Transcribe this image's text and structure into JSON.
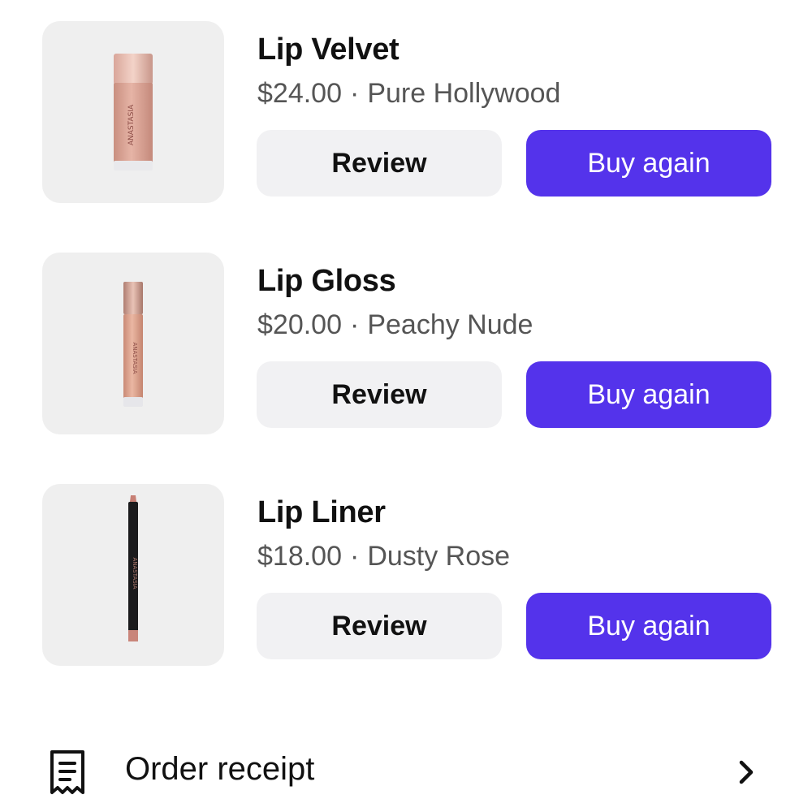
{
  "items": [
    {
      "name": "Lip Velvet",
      "price": "$24.00",
      "separator": "·",
      "shade": "Pure Hollywood",
      "review_label": "Review",
      "buy_label": "Buy again",
      "image_icon": "lip-velvet-bottle-icon"
    },
    {
      "name": "Lip Gloss",
      "price": "$20.00",
      "separator": "·",
      "shade": "Peachy Nude",
      "review_label": "Review",
      "buy_label": "Buy again",
      "image_icon": "lip-gloss-tube-icon"
    },
    {
      "name": "Lip Liner",
      "price": "$18.00",
      "separator": "·",
      "shade": "Dusty Rose",
      "review_label": "Review",
      "buy_label": "Buy again",
      "image_icon": "lip-liner-pencil-icon"
    }
  ],
  "receipt": {
    "label": "Order receipt",
    "icon": "receipt-icon",
    "chevron_icon": "chevron-right-icon"
  },
  "colors": {
    "accent": "#5433eb",
    "secondary_button": "#f1f1f3",
    "thumb_background": "#efefef"
  }
}
